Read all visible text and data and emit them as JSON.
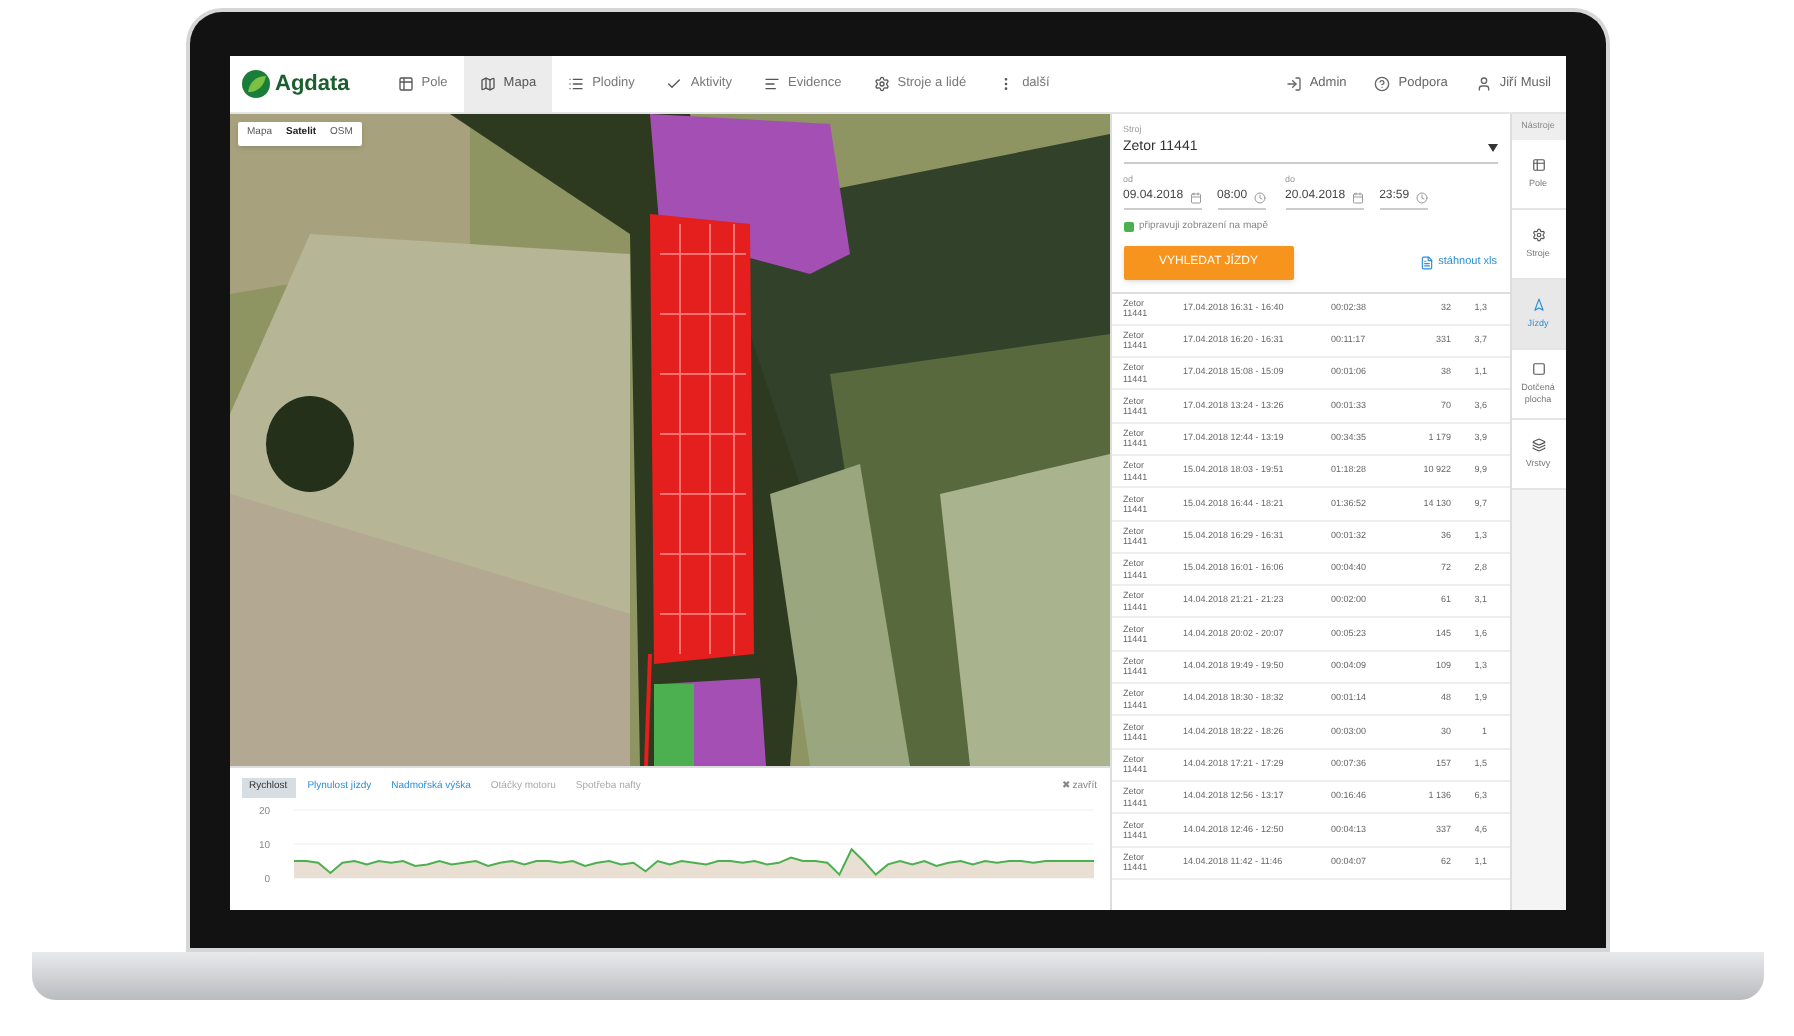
{
  "nav": {
    "logo": "Agdata",
    "items": [
      {
        "label": "Pole",
        "selected": false
      },
      {
        "label": "Mapa",
        "selected": true
      },
      {
        "label": "Plodiny",
        "selected": false
      },
      {
        "label": "Aktivity",
        "selected": false
      },
      {
        "label": "Evidence",
        "selected": false
      },
      {
        "label": "Stroje a lidé",
        "selected": false
      },
      {
        "label": "další",
        "selected": false
      }
    ],
    "user_items": [
      {
        "label": "Admin"
      },
      {
        "label": "Podpora"
      },
      {
        "label": "Jiří Musil"
      }
    ]
  },
  "map": {
    "layers": [
      {
        "label": "Mapa",
        "selected": false
      },
      {
        "label": "Satelit",
        "selected": true
      },
      {
        "label": "OSM",
        "selected": false
      }
    ]
  },
  "chart_panel": {
    "tabs": [
      {
        "label": "Rychlost",
        "selected": true,
        "disabled": false
      },
      {
        "label": "Plynulost jízdy",
        "selected": false,
        "disabled": false
      },
      {
        "label": "Nadmořská výška",
        "selected": false,
        "disabled": false
      },
      {
        "label": "Otáčky motoru",
        "selected": false,
        "disabled": true
      },
      {
        "label": "Spotřeba nafty",
        "selected": false,
        "disabled": true
      }
    ],
    "close": "✖ zavřít",
    "chart_data": {
      "type": "line",
      "ylim": [
        0,
        20
      ],
      "yticks": [
        0,
        10,
        20
      ],
      "series": [
        {
          "color": "#4caf50",
          "values": [
            5,
            5,
            4.5,
            1.5,
            4.5,
            5,
            4,
            5,
            4.5,
            5,
            3.5,
            4,
            5,
            4,
            4.5,
            5,
            3.5,
            4.5,
            5,
            4,
            5,
            5,
            4.5,
            5,
            3.5,
            4.5,
            5,
            4,
            4.5,
            2,
            5,
            4,
            5,
            4.5,
            4,
            5,
            5,
            4.5,
            5,
            4,
            4.5,
            6,
            5,
            5,
            4.5,
            1,
            8.5,
            5,
            1,
            4,
            5,
            4,
            5,
            3.5,
            4.5,
            5,
            4,
            5,
            4.5,
            5,
            5,
            4.5,
            5,
            5,
            5,
            5,
            5
          ]
        }
      ]
    }
  },
  "search": {
    "machine_label": "Stroj",
    "machine": "Zetor 11441",
    "from_label": "od",
    "from_date": "09.04.2018",
    "from_time": "08:00",
    "to_label": "do",
    "to_date": "20.04.2018",
    "to_time": "23:59",
    "status": "připravuji zobrazení na mapě",
    "button": "VYHLEDAT JÍZDY",
    "download": "stáhnout xls"
  },
  "rides": [
    {
      "machine": "Zetor 11441",
      "time": "17.04.2018 16:31 - 16:40",
      "duration": "00:02:38",
      "column_4": "32",
      "column_5": "1,3"
    },
    {
      "machine": "Zetor 11441",
      "time": "17.04.2018 16:20 - 16:31",
      "duration": "00:11:17",
      "column_4": "331",
      "column_5": "3,7"
    },
    {
      "machine": "Zetor 11441",
      "time": "17.04.2018 15:08 - 15:09",
      "duration": "00:01:06",
      "column_4": "38",
      "column_5": "1,1"
    },
    {
      "machine": "Zetor 11441",
      "time": "17.04.2018 13:24 - 13:26",
      "duration": "00:01:33",
      "column_4": "70",
      "column_5": "3,6"
    },
    {
      "machine": "Zetor 11441",
      "time": "17.04.2018 12:44 - 13:19",
      "duration": "00:34:35",
      "column_4": "1 179",
      "column_5": "3,9"
    },
    {
      "machine": "Zetor 11441",
      "time": "15.04.2018 18:03 - 19:51",
      "duration": "01:18:28",
      "column_4": "10 922",
      "column_5": "9,9"
    },
    {
      "machine": "Zetor 11441",
      "time": "15.04.2018 16:44 - 18:21",
      "duration": "01:36:52",
      "column_4": "14 130",
      "column_5": "9,7"
    },
    {
      "machine": "Zetor 11441",
      "time": "15.04.2018 16:29 - 16:31",
      "duration": "00:01:32",
      "column_4": "36",
      "column_5": "1,3"
    },
    {
      "machine": "Zetor 11441",
      "time": "15.04.2018 16:01 - 16:06",
      "duration": "00:04:40",
      "column_4": "72",
      "column_5": "2,8"
    },
    {
      "machine": "Zetor 11441",
      "time": "14.04.2018 21:21 - 21:23",
      "duration": "00:02:00",
      "column_4": "61",
      "column_5": "3,1"
    },
    {
      "machine": "Zetor 11441",
      "time": "14.04.2018 20:02 - 20:07",
      "duration": "00:05:23",
      "column_4": "145",
      "column_5": "1,6"
    },
    {
      "machine": "Zetor 11441",
      "time": "14.04.2018 19:49 - 19:50",
      "duration": "00:04:09",
      "column_4": "109",
      "column_5": "1,3"
    },
    {
      "machine": "Zetor 11441",
      "time": "14.04.2018 18:30 - 18:32",
      "duration": "00:01:14",
      "column_4": "48",
      "column_5": "1,9"
    },
    {
      "machine": "Zetor 11441",
      "time": "14.04.2018 18:22 - 18:26",
      "duration": "00:03:00",
      "column_4": "30",
      "column_5": "1"
    },
    {
      "machine": "Zetor 11441",
      "time": "14.04.2018 17:21 - 17:29",
      "duration": "00:07:36",
      "column_4": "157",
      "column_5": "1,5"
    },
    {
      "machine": "Zetor 11441",
      "time": "14.04.2018 12:56 - 13:17",
      "duration": "00:16:46",
      "column_4": "1 136",
      "column_5": "6,3"
    },
    {
      "machine": "Zetor 11441",
      "time": "14.04.2018 12:46 - 12:50",
      "duration": "00:04:13",
      "column_4": "337",
      "column_5": "4,6"
    },
    {
      "machine": "Zetor 11441",
      "time": "14.04.2018 11:42 - 11:46",
      "duration": "00:04:07",
      "column_4": "62",
      "column_5": "1,1"
    }
  ],
  "tools": {
    "title": "Nástroje",
    "items": [
      {
        "label": "Pole",
        "selected": false
      },
      {
        "label": "Stroje",
        "selected": false
      },
      {
        "label": "Jízdy",
        "selected": true
      },
      {
        "label": "Dotčená plocha",
        "selected": false
      },
      {
        "label": "Vrstvy",
        "selected": false
      }
    ]
  }
}
